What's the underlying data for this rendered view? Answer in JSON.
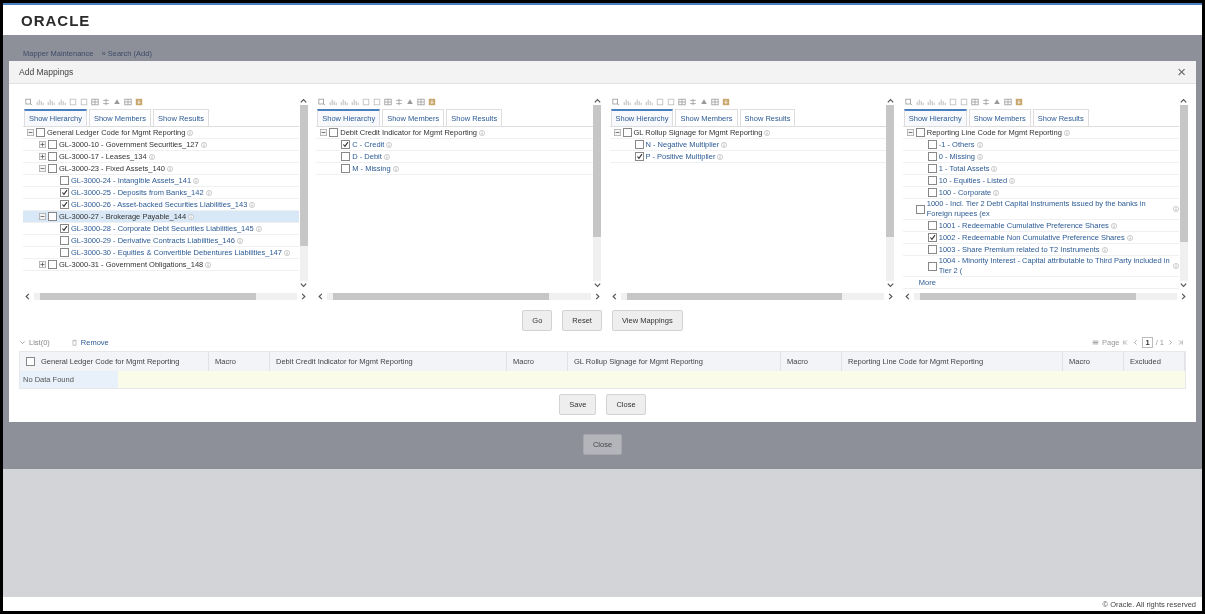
{
  "header": {
    "logo": "ORACLE"
  },
  "breadcrumb": [
    "Mapper Maintenance",
    "» Search  (Add)"
  ],
  "dialog": {
    "title": "Add Mappings",
    "close": "×",
    "panels": [
      {
        "tabs": [
          {
            "label": "Show Hierarchy",
            "selected": true
          },
          {
            "label": "Show Members",
            "selected": false
          },
          {
            "label": "Show Results",
            "selected": false
          }
        ],
        "tree": [
          {
            "label": "General Ledger Code for Mgmt Reporting",
            "checked": false,
            "expanded": true,
            "selected": false,
            "children": [
              {
                "label": "GL-3000-10 - Government Securities_127",
                "checked": false,
                "expanded": false,
                "selected": false
              },
              {
                "label": "GL-3000-17 - Leases_134",
                "checked": false,
                "expanded": false,
                "selected": false
              },
              {
                "label": "GL-3000-23 - Fixed Assets_140",
                "checked": false,
                "expanded": true,
                "selected": false,
                "children": [
                  {
                    "label": "GL-3000-24 - Intangible Assets_141",
                    "checked": false,
                    "selected": false
                  },
                  {
                    "label": "GL-3000-25 - Deposits from Banks_142",
                    "checked": true,
                    "selected": false
                  },
                  {
                    "label": "GL-3000-26 - Asset-backed Securities Liabilities_143",
                    "checked": true,
                    "selected": false
                  }
                ]
              },
              {
                "label": "GL-3000-27 - Brokerage Payable_144",
                "checked": false,
                "expanded": true,
                "selected": true,
                "children": [
                  {
                    "label": "GL-3000-28 - Corporate Debt Securities Liabilities_145",
                    "checked": true,
                    "selected": false
                  },
                  {
                    "label": "GL-3000-29 - Derivative Contracts Liabilities_146",
                    "checked": false,
                    "selected": false
                  },
                  {
                    "label": "GL-3000-30 - Equities & Convertible Debentures Liabilities_147",
                    "checked": false,
                    "selected": false
                  }
                ]
              },
              {
                "label": "GL-3000-31 - Government Obligations_148",
                "checked": false,
                "expanded": false,
                "selected": false
              }
            ]
          }
        ]
      },
      {
        "tabs": [
          {
            "label": "Show Hierarchy",
            "selected": true
          },
          {
            "label": "Show Members",
            "selected": false
          },
          {
            "label": "Show Results",
            "selected": false
          }
        ],
        "tree": [
          {
            "label": "Debit Credit Indicator for Mgmt Reporting",
            "checked": false,
            "expanded": true,
            "selected": false,
            "children": [
              {
                "label": "C - Credit",
                "checked": true,
                "selected": false
              },
              {
                "label": "D - Debit",
                "checked": false,
                "selected": false
              },
              {
                "label": "M - Missing",
                "checked": false,
                "selected": false
              }
            ]
          }
        ]
      },
      {
        "tabs": [
          {
            "label": "Show Hierarchy",
            "selected": true
          },
          {
            "label": "Show Members",
            "selected": false
          },
          {
            "label": "Show Results",
            "selected": false
          }
        ],
        "tree": [
          {
            "label": "GL Rollup Signage for Mgmt Reporting",
            "checked": false,
            "expanded": true,
            "selected": false,
            "children": [
              {
                "label": "N - Negative Multiplier",
                "checked": false,
                "selected": false
              },
              {
                "label": "P - Positive Multiplier",
                "checked": true,
                "selected": false
              }
            ]
          }
        ]
      },
      {
        "tabs": [
          {
            "label": "Show Hierarchy",
            "selected": true
          },
          {
            "label": "Show Members",
            "selected": false
          },
          {
            "label": "Show Results",
            "selected": false
          }
        ],
        "tree": [
          {
            "label": "Reporting Line Code for Mgmt Reporting",
            "checked": false,
            "expanded": true,
            "selected": false,
            "children": [
              {
                "label": "-1 - Others",
                "checked": false,
                "selected": false
              },
              {
                "label": "0 - Missing",
                "checked": false,
                "selected": false
              },
              {
                "label": "1 - Total Assets",
                "checked": false,
                "selected": false
              },
              {
                "label": "10 - Equities - Listed",
                "checked": false,
                "selected": false
              },
              {
                "label": "100 - Corporate",
                "checked": false,
                "selected": false
              }
            ]
          },
          {
            "label": "1000 - Incl. Tier 2 Debt Capital Instruments issued by the banks in Foreign rupees (ex",
            "checked": false,
            "selected": false,
            "more": "More",
            "children": [
              {
                "label": "1001 - Redeemable Cumulative Preference Shares",
                "checked": false,
                "selected": false
              },
              {
                "label": "1002 - Redeemable Non Cumulative Preference Shares",
                "checked": true,
                "selected": false
              },
              {
                "label": "1003 - Share Premium related to T2 Instruments",
                "checked": false,
                "selected": false
              },
              {
                "label": "1004 - Minority Interest - Capital attributable to Third Party included in Tier 2 (",
                "checked": false,
                "selected": false
              }
            ]
          }
        ]
      }
    ],
    "actions": [
      "Go",
      "Reset",
      "View Mappings"
    ],
    "list": {
      "label": "List(0)",
      "expanded": true,
      "remove": "Remove"
    },
    "pager": {
      "label": "Page",
      "current": "1",
      "total": "/ 1"
    },
    "table": {
      "all_checked": false,
      "columns": [
        "General Ledger Code for Mgmt Reporting",
        "Macro",
        "Debit Credit Indicator for Mgmt Reporting",
        "Macro",
        "GL Rollup Signage for Mgmt Reporting",
        "Macro",
        "Reporting Line Code for Mgmt Reporting",
        "Macro",
        "Excluded"
      ],
      "empty": "No Data Found"
    },
    "buttons": [
      "Save",
      "Close"
    ]
  },
  "page_button": "Close",
  "footer": "© Oracle. All rights reserved"
}
